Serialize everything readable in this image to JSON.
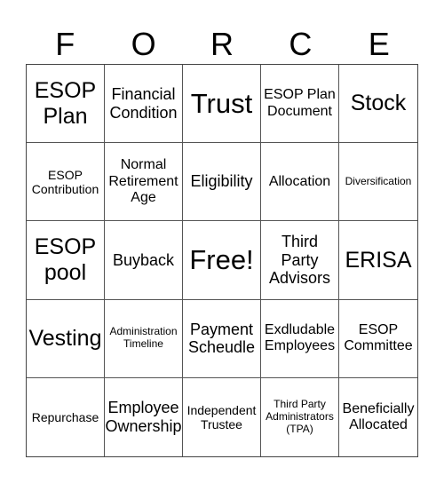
{
  "title_letters": [
    "F",
    "O",
    "R",
    "C",
    "E"
  ],
  "cells": [
    [
      "ESOP Plan",
      "Financial Condition",
      "Trust",
      "ESOP Plan Document",
      "Stock"
    ],
    [
      "ESOP Contribution",
      "Normal Retirement Age",
      "Eligibility",
      "Allocation",
      "Diversification"
    ],
    [
      "ESOP pool",
      "Buyback",
      "Free!",
      "Third Party Advisors",
      "ERISA"
    ],
    [
      "Vesting",
      "Administration Timeline",
      "Payment Scheudle",
      "Exdludable Employees",
      "ESOP Committee"
    ],
    [
      "Repurchase",
      "Employee Ownership",
      "Independent Trustee",
      "Third Party Administrators (TPA)",
      "Beneficially Allocated"
    ]
  ],
  "free_space": "Free!"
}
